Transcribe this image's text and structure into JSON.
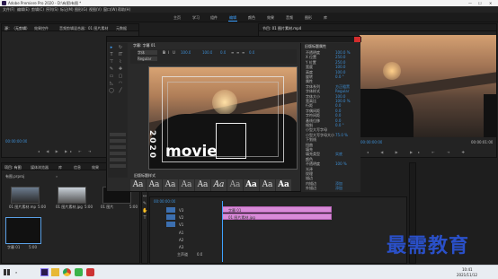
{
  "app": {
    "title": "Adobe Premiere Pro 2020 - D:\\有图\\有图 *",
    "menus": [
      "文件(F)",
      "编辑(E)",
      "剪辑(C)",
      "序列(S)",
      "标记(M)",
      "图形(G)",
      "视图(V)",
      "窗口(W)",
      "帮助(H)"
    ]
  },
  "workspaces": {
    "tabs": [
      "主页",
      "学习",
      "组件",
      "编辑",
      "颜色",
      "效果",
      "音频",
      "图形",
      "库"
    ],
    "active": 3
  },
  "source_panel": {
    "tabs": [
      "源：（无剪辑）",
      "效果控件",
      "音频剪辑混合器：01 图片素材",
      "元数据"
    ],
    "timecode_left": "00:00:00:00",
    "timecode_right": "00:00:00:00"
  },
  "program_panel": {
    "tab": "节目: 01 图片素材.mp4",
    "timecode": "00:00:00:00",
    "timecode_right": "00:00:01:00"
  },
  "title_dialog": {
    "tab": "字幕: 字幕 01",
    "font_family": "字体",
    "font_style": "Regular",
    "size_value": "100.0",
    "kerning_value": "100.0",
    "leading_value": "0.0",
    "tracking_value": "0.0",
    "styles_header": "旧版标题样式",
    "style_label": "Aa"
  },
  "title_text": {
    "year": "2020",
    "word": "movie"
  },
  "properties_panel": {
    "title": "旧版标题属性",
    "sections": [
      "变换",
      "属性",
      "填充",
      "描边",
      "阴影",
      "背景"
    ],
    "rows": [
      {
        "label": "不透明度",
        "value": "100.0 %"
      },
      {
        "label": "X 位置",
        "value": "250.0"
      },
      {
        "label": "Y 位置",
        "value": "250.0"
      },
      {
        "label": "宽度",
        "value": "100.0"
      },
      {
        "label": "高度",
        "value": "100.0"
      },
      {
        "label": "旋转",
        "value": "0.0 °"
      },
      {
        "label": "属性",
        "value": ""
      },
      {
        "label": "字体系列",
        "value": "方正粗黑"
      },
      {
        "label": "字体样式",
        "value": "Regular"
      },
      {
        "label": "字体大小",
        "value": "100.0"
      },
      {
        "label": "宽高比",
        "value": "100.0 %"
      },
      {
        "label": "行距",
        "value": "0.0"
      },
      {
        "label": "字偶间距",
        "value": "0.0"
      },
      {
        "label": "字符间距",
        "value": "0.0"
      },
      {
        "label": "基线位移",
        "value": "0.0"
      },
      {
        "label": "倾斜",
        "value": "0.0 °"
      },
      {
        "label": "小型大写字母",
        "value": ""
      },
      {
        "label": "小型大写字母大小",
        "value": "75.0 %"
      },
      {
        "label": "下划线",
        "value": ""
      },
      {
        "label": "扭曲",
        "value": ""
      },
      {
        "label": "填充",
        "value": ""
      },
      {
        "label": "填充类型",
        "value": "实底"
      },
      {
        "label": "颜色",
        "value": ""
      },
      {
        "label": "不透明度",
        "value": "100 %"
      },
      {
        "label": "光泽",
        "value": ""
      },
      {
        "label": "纹理",
        "value": ""
      },
      {
        "label": "描边",
        "value": ""
      },
      {
        "label": "内描边",
        "value": "添加"
      },
      {
        "label": "外描边",
        "value": "添加"
      }
    ]
  },
  "project_panel": {
    "tabs": [
      "项目: 有图",
      "媒体浏览器",
      "库",
      "信息",
      "效果"
    ],
    "path": "有图.prproj",
    "items": [
      {
        "name": "01 图片素材.mp4",
        "dur": "5:00"
      },
      {
        "name": "01 图片素材.jpg",
        "dur": "5:00"
      },
      {
        "name": "01 图片",
        "dur": "5:00"
      },
      {
        "name": "字幕 01",
        "dur": "5:00"
      }
    ]
  },
  "timeline": {
    "timecode": "00:00:00:00",
    "tracks": [
      "V3",
      "V2",
      "V1",
      "A1",
      "A2",
      "A3",
      "主声道"
    ],
    "clip_title": "字幕 01",
    "clip_image": "01 图片素材.jpg",
    "master_value": "0.0"
  },
  "taskbar": {
    "time": "10:41",
    "date": "2021/11/12"
  },
  "watermark": "最需教育",
  "colors": {
    "accent": "#3ea2ff",
    "clip": "#d88bd8",
    "clip_border": "#b460b4",
    "taskbar": "#e9edf2",
    "dialog_close": "#d32d2d"
  }
}
